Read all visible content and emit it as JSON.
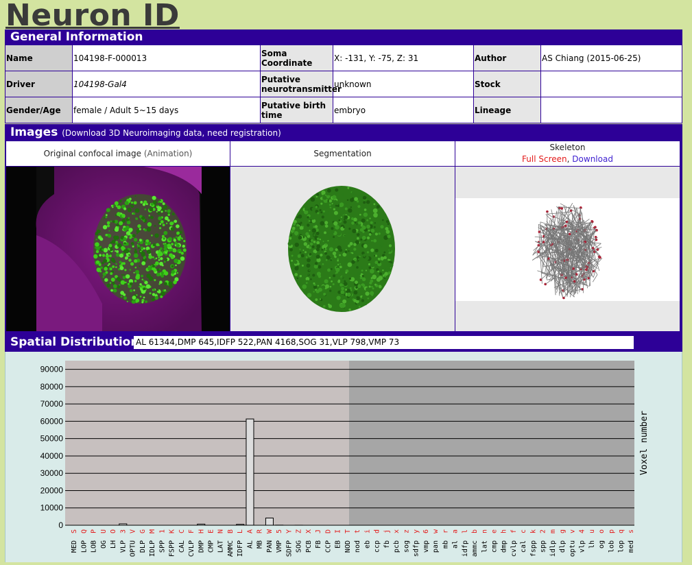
{
  "page": {
    "title": "Neuron ID"
  },
  "general": {
    "heading": "General Information",
    "rows": [
      [
        {
          "label": "Name",
          "value": "104198-F-000013"
        },
        {
          "label": "Soma Coordinate",
          "value": "X: -131, Y: -75, Z: 31"
        },
        {
          "label": "Author",
          "value": "AS Chiang (2015-06-25)"
        }
      ],
      [
        {
          "label": "Driver",
          "value": "104198-Gal4"
        },
        {
          "label": "Putative neurotransmitter",
          "value": "unknown"
        },
        {
          "label": "Stock",
          "value": ""
        }
      ],
      [
        {
          "label": "Gender/Age",
          "value": "female / Adult 5~15 days"
        },
        {
          "label": "Putative birth time",
          "value": "embryo"
        },
        {
          "label": "Lineage",
          "value": ""
        }
      ]
    ]
  },
  "images": {
    "heading": "Images",
    "note": "(Download 3D Neuroimaging data, need registration)",
    "col1_label": "Original confocal image",
    "col1_link": "(Animation)",
    "col2_label": "Segmentation",
    "col3_label": "Skeleton",
    "col3_link1": "Full Screen",
    "col3_sep": ",",
    "col3_link2": "Download"
  },
  "spatial": {
    "heading": "Spatial Distribution",
    "summary": "AL 61344,DMP 645,IDFP 522,PAN 4168,SOG 31,VLP 798,VMP 73"
  },
  "colors": {
    "bar": "#2d0097",
    "page_bg": "#d3e4a0",
    "chart_bg": "#d9ebe9",
    "left_panel": "#c7c0bf",
    "right_panel": "#a6a6a6",
    "letters": "#e31a1a"
  },
  "chart_data": {
    "type": "bar",
    "ylabel": "Voxel number",
    "ylim": [
      0,
      95000
    ],
    "yticks": [
      0,
      10000,
      20000,
      30000,
      40000,
      50000,
      60000,
      70000,
      80000,
      90000
    ],
    "categories": [
      "MED",
      "LOP",
      "LOB",
      "OG",
      "LH",
      "VLP",
      "OPTU",
      "DLP",
      "IDLP",
      "SPP",
      "FSPP",
      "CAL",
      "CVLP",
      "DMP",
      "CMP",
      "LAT",
      "AMMC",
      "IDFP",
      "AL",
      "MB",
      "PAN",
      "VMP",
      "SDFP",
      "SOG",
      "PCB",
      "FB",
      "CCP",
      "EB",
      "NOD",
      "nod",
      "eb",
      "ccp",
      "fb",
      "pcb",
      "sog",
      "sdfp",
      "vmp",
      "pan",
      "mb",
      "al",
      "idfp",
      "ammc",
      "lat",
      "cmp",
      "dmp",
      "cvlp",
      "cal",
      "fspp",
      "spp",
      "idlp",
      "dlp",
      "optu",
      "vlp",
      "lh",
      "og",
      "lob",
      "lop",
      "med"
    ],
    "letters": [
      "S",
      "Q",
      "P",
      "U",
      "O",
      "3",
      "V",
      "G",
      "M",
      "1",
      "K",
      "C",
      "F",
      "H",
      "E",
      "N",
      "B",
      "L",
      "A",
      "R",
      "W",
      "5",
      "Y",
      "Z",
      "X",
      "J",
      "D",
      "I",
      "T",
      "t",
      "i",
      "d",
      "j",
      "x",
      "z",
      "y",
      "6",
      "w",
      "r",
      "a",
      "l",
      "b",
      "n",
      "e",
      "h",
      "f",
      "c",
      "k",
      "2",
      "m",
      "g",
      "v",
      "4",
      "u",
      "o",
      "p",
      "q",
      "s"
    ],
    "values": [
      0,
      0,
      0,
      0,
      0,
      798,
      0,
      0,
      0,
      0,
      0,
      0,
      0,
      645,
      0,
      0,
      0,
      522,
      61344,
      0,
      4168,
      73,
      0,
      31,
      0,
      0,
      0,
      0,
      0,
      0,
      0,
      0,
      0,
      0,
      0,
      0,
      0,
      0,
      0,
      0,
      0,
      0,
      0,
      0,
      0,
      0,
      0,
      0,
      0,
      0,
      0,
      0,
      0,
      0,
      0,
      0,
      0,
      0
    ]
  }
}
